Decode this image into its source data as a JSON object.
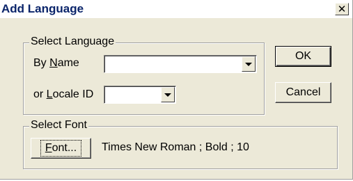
{
  "dialog": {
    "title": "Add Language",
    "close_glyph": "✕"
  },
  "select_language": {
    "caption": "Select Language",
    "by_name_label_pre": "By ",
    "by_name_label_u": "N",
    "by_name_label_post": "ame",
    "by_name_value": "",
    "locale_label_pre": "or ",
    "locale_label_u": "L",
    "locale_label_post": "ocale ID",
    "locale_value": ""
  },
  "buttons": {
    "ok": "OK",
    "cancel": "Cancel"
  },
  "select_font": {
    "caption": "Select Font",
    "font_button_u": "F",
    "font_button_rest": "ont...",
    "current_font": "Times New Roman ; Bold ; 10"
  },
  "icons": {
    "close": "close-icon",
    "dropdown": "chevron-down-icon"
  }
}
